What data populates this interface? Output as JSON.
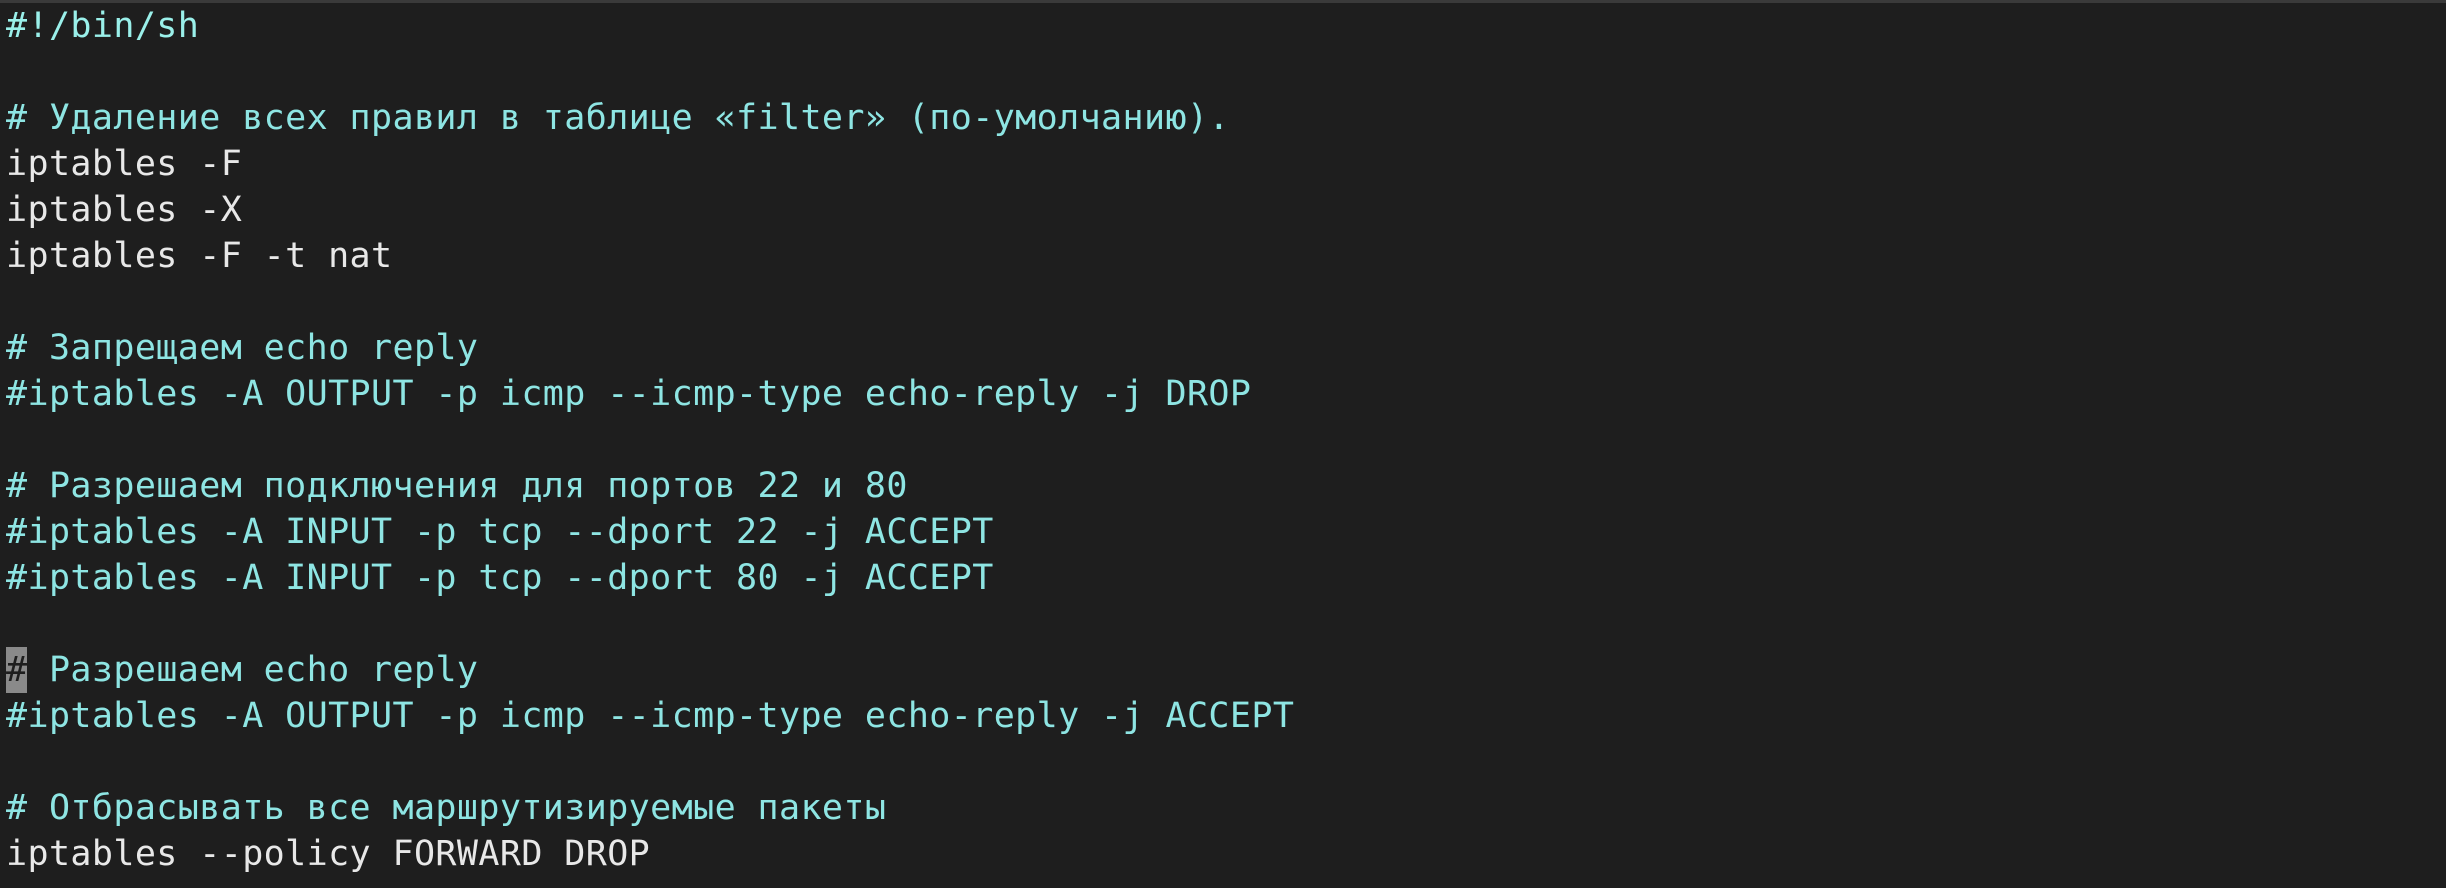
{
  "editor": {
    "lines": [
      "#!/bin/sh",
      "",
      "# Удаление всех правил в таблице «filter» (по-умолчанию).",
      "iptables -F",
      "iptables -X",
      "iptables -F -t nat",
      "",
      "# Запрещаем echo reply",
      "#iptables -A OUTPUT -p icmp --icmp-type echo-reply -j DROP",
      "",
      "# Разрешаем подключения для портов 22 и 80",
      "#iptables -A INPUT -p tcp --dport 22 -j ACCEPT",
      "#iptables -A INPUT -p tcp --dport 80 -j ACCEPT",
      "",
      "#",
      " Разрешаем echo reply",
      "#iptables -A OUTPUT -p icmp --icmp-type echo-reply -j ACCEPT",
      "",
      "# Отбрасывать все маршрутизируемые пакеты",
      "iptables --policy FORWARD DROP"
    ],
    "colors": {
      "background": "#1e1e1e",
      "comment": "#8ee5e3",
      "code": "#e8e8e8",
      "cursor": "#8a8a8a"
    }
  }
}
